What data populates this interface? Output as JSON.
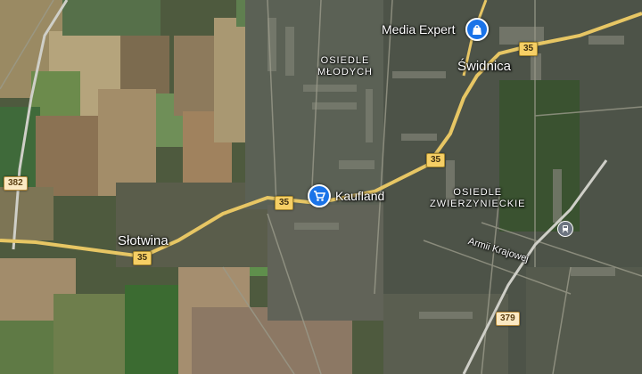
{
  "map": {
    "places": [
      {
        "name": "Świdnica"
      },
      {
        "name": "Słotwina"
      }
    ],
    "districts": [
      {
        "line1": "OSIEDLE",
        "line2": "MŁODYCH"
      },
      {
        "line1": "OSIEDLE",
        "line2": "ZWIERZYNIECKIE"
      }
    ],
    "pois": [
      {
        "name": "Media Expert",
        "icon": "shopping-bag-icon",
        "color": "#1a73e8"
      },
      {
        "name": "Kaufland",
        "icon": "shopping-cart-icon",
        "color": "#1a73e8"
      }
    ],
    "roads": [
      {
        "ref": "35"
      },
      {
        "ref": "35"
      },
      {
        "ref": "35"
      },
      {
        "ref": "35"
      },
      {
        "ref": "382"
      },
      {
        "ref": "379"
      }
    ],
    "streets": [
      {
        "name": "Armii Krajowej"
      }
    ],
    "transit": {
      "icon": "train-station-icon"
    }
  }
}
